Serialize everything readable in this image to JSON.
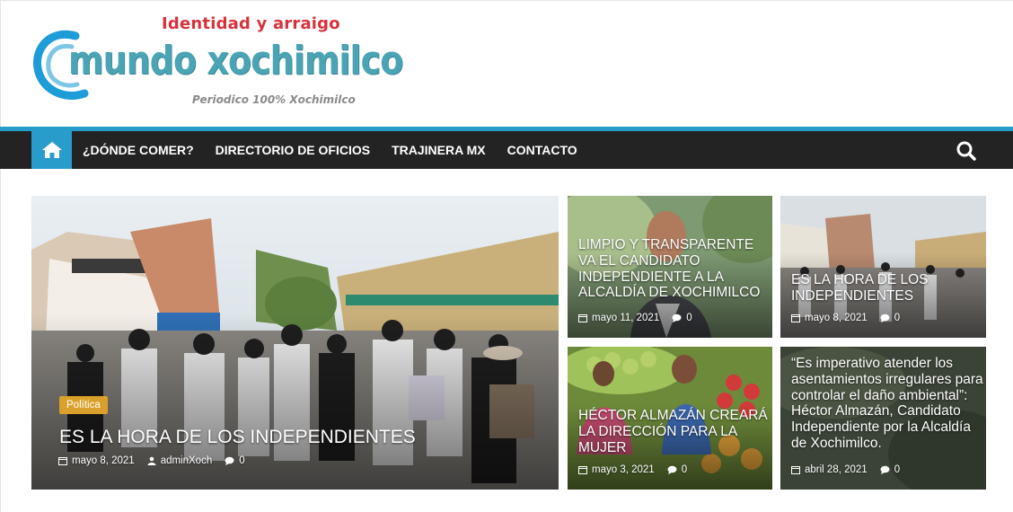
{
  "header": {
    "logo_tagline": "Identidad y arraigo",
    "logo_name": "mundo xochimilco",
    "logo_subtitle": "Periodico 100% Xochimilco"
  },
  "nav": {
    "home_icon": "home-icon",
    "items": [
      {
        "label": "¿DÓNDE COMER?"
      },
      {
        "label": "DIRECTORIO DE OFICIOS"
      },
      {
        "label": "TRAJINERA MX"
      },
      {
        "label": "CONTACTO"
      }
    ],
    "search_icon": "search-icon"
  },
  "featured": {
    "category": "Política",
    "title": "ES LA HORA DE LOS INDEPENDIENTES",
    "date": "mayo 8, 2021",
    "author": "adminXoch",
    "comments": "0"
  },
  "posts": [
    {
      "title": "LIMPIO Y TRANSPARENTE VA EL CANDIDATO INDEPENDIENTE A LA ALCALDÍA DE XOCHIMILCO",
      "date": "mayo 11, 2021",
      "comments": "0"
    },
    {
      "title": "ES LA HORA DE LOS INDEPENDIENTES",
      "date": "mayo 8, 2021",
      "comments": "0"
    },
    {
      "title": "HÉCTOR ALMAZÁN CREARÁ LA DIRECCIÓN PARA LA MUJER",
      "date": "mayo 3, 2021",
      "comments": "0"
    },
    {
      "title": "“Es imperativo atender los asentamientos irregulares para controlar el daño ambiental”: Héctor Almazán, Candidato Independiente por la Alcaldía de Xochimilco.",
      "date": "abril 28, 2021",
      "comments": "0"
    }
  ],
  "colors": {
    "accent": "#289dcc",
    "nav_bg": "#232323",
    "badge": "#d9a12b",
    "logo_teal": "#4aa4b4",
    "logo_red": "#d6323c"
  }
}
